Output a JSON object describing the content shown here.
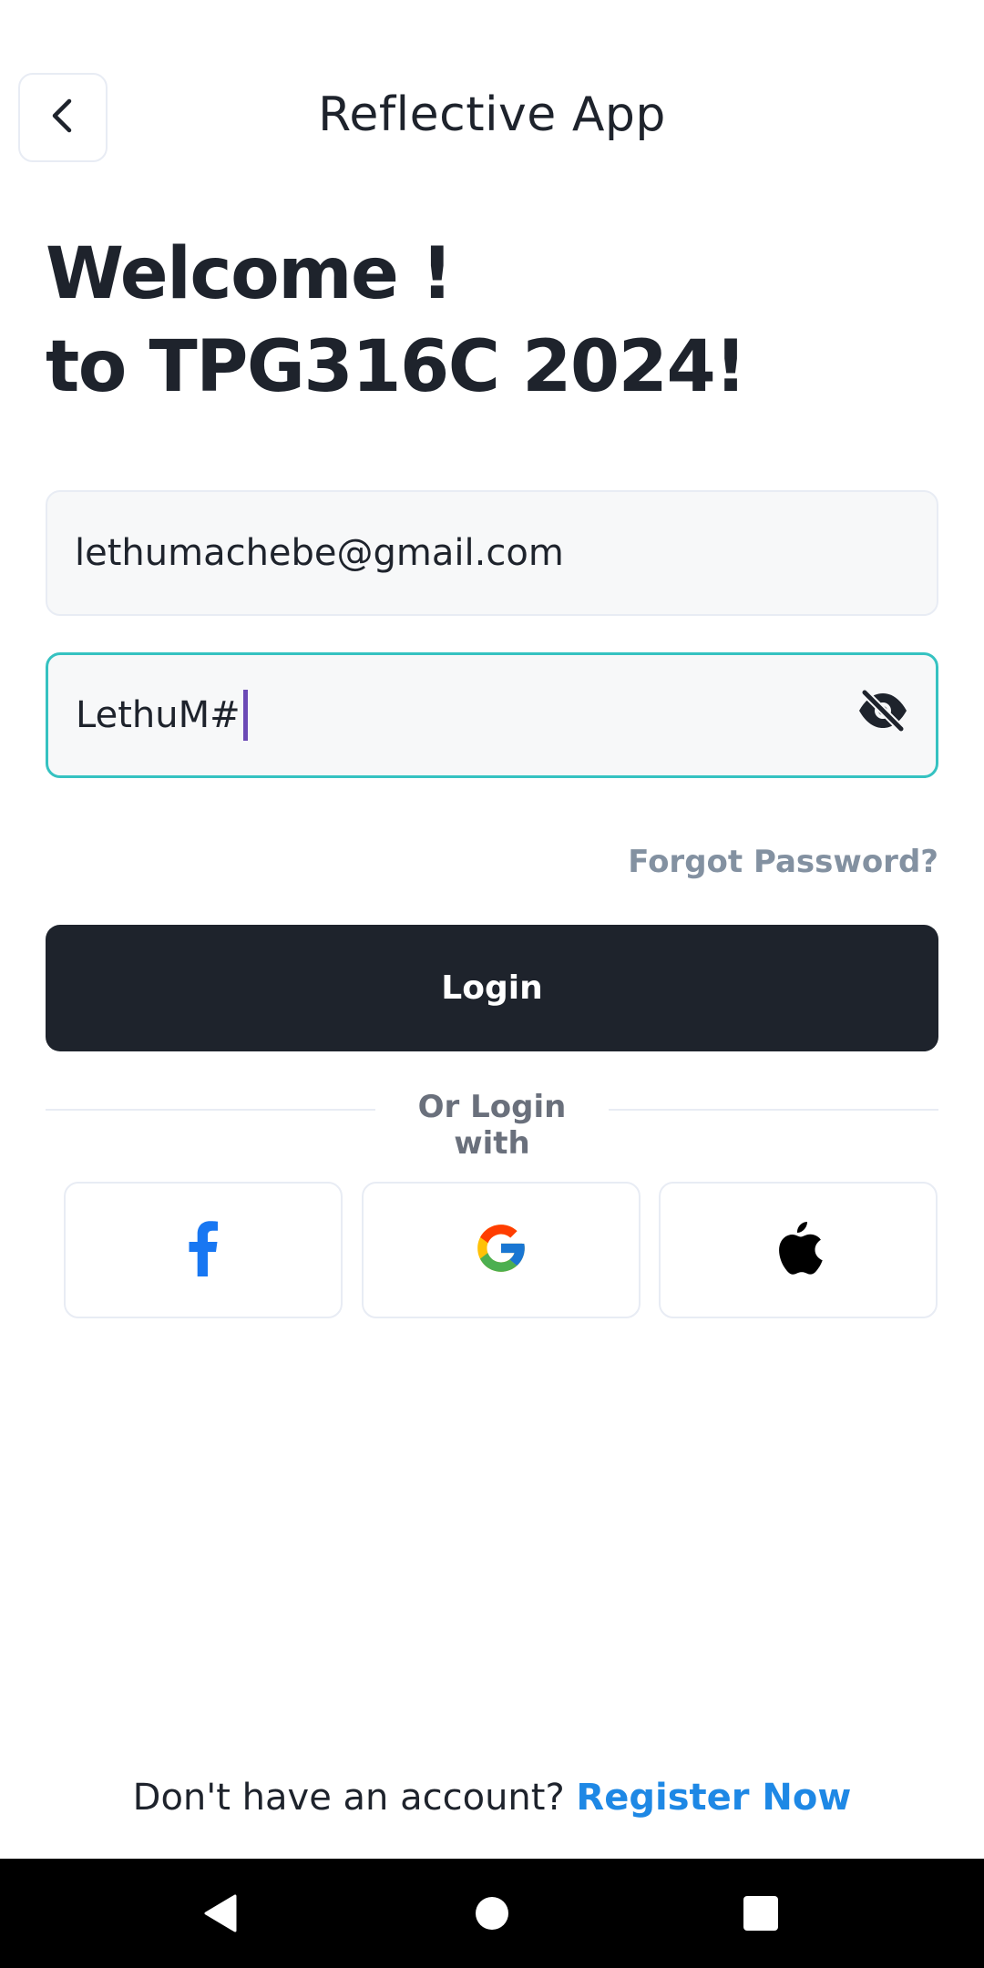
{
  "header": {
    "back_icon": "chevron-left-icon",
    "title": "Reflective App"
  },
  "welcome": {
    "line1": "Welcome !",
    "line2": "to TPG316C 2024!"
  },
  "form": {
    "email_value": "lethumachebe@gmail.com",
    "password_value": "LethuM#",
    "password_toggle_icon": "eye-off-icon",
    "forgot_label": "Forgot Password?",
    "login_label": "Login"
  },
  "social": {
    "divider_label": "Or Login with",
    "providers": [
      {
        "name": "facebook",
        "icon": "facebook-icon",
        "color": "#1877f2"
      },
      {
        "name": "google",
        "icon": "google-icon"
      },
      {
        "name": "apple",
        "icon": "apple-icon",
        "color": "#000000"
      }
    ]
  },
  "footer": {
    "prompt": "Don't have an account?",
    "register_label": "Register Now",
    "link_color": "#1e88e5"
  },
  "navbar": {
    "back_icon": "nav-back-icon",
    "home_icon": "nav-home-icon",
    "recent_icon": "nav-recents-icon"
  },
  "colors": {
    "primary_dark": "#1e232c",
    "focus_border": "#35c2c1",
    "field_bg": "#f7f8f9"
  }
}
